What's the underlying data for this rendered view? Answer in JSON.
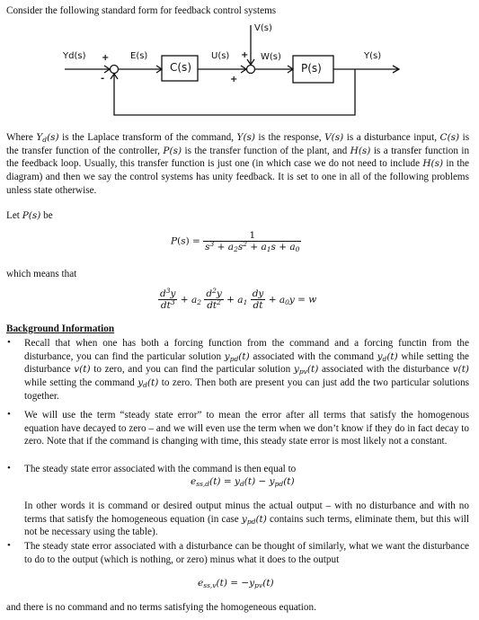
{
  "intro": "Consider the following standard form for feedback control systems",
  "diagram": {
    "labels": {
      "command": "Yd(s)",
      "error": "E(s)",
      "controller": "C(s)",
      "control": "U(s)",
      "disturbance": "V(s)",
      "plant_input": "W(s)",
      "plant": "P(s)",
      "output": "Y(s)"
    },
    "signs": {
      "sum1_top": "+",
      "sum1_bottom": "-",
      "sum2_top": "+",
      "sum2_left": "+"
    }
  },
  "definitions": {
    "p1": "is the Laplace transform of the command,",
    "p2": "is the response,",
    "p3": "is a disturbance input,",
    "p4": "is the transfer function of the controller,",
    "p5": "is the transfer function of the plant, and",
    "p6": "is a transfer function in the feedback loop. Usually, this transfer function is just one (in which case we do not need to include",
    "p7": "in the diagram) and then we say the control systems has unity feedback. It is set to one in all of the following problems unless state otherwise.",
    "where": "Where"
  },
  "let": {
    "prefix": "Let",
    "suffix": "be"
  },
  "equations": {
    "plant_tf_lhs": "P(s) =",
    "plant_tf_num": "1",
    "ode_rhs": "= w",
    "which_means": "which means that"
  },
  "background": {
    "heading": "Background Information",
    "b1": {
      "t1": "Recall that when one has both a forcing function from the command and a forcing functin from the disturbance, you can find the particular solution",
      "t2": "associated with the command",
      "t3": "while setting the disturbance",
      "t4": "to zero, and you can find the particular solution",
      "t5": "associated with the disturbance",
      "t6": "while setting the command",
      "t7": "to zero. Then both are present you can just add the two particular solutions together."
    },
    "b2": "We will use the term “steady state error” to mean the error after all terms that satisfy the homogenous equation have decayed to zero – and we will even use the term when we don’t know if they do in fact decay to zero. Note that if the command is changing with time, this steady state error is most likely not a constant.",
    "b3": {
      "t1": "The steady state error associated with the command is then equal to",
      "t2": "In other words it is command or desired output minus the actual output – with no disturbance and with no terms that satisfy the homogeneous equation (in case",
      "t3": "contains such terms, eliminate them, but this will not be necessary using the table)."
    },
    "b4": "The steady state error associated with a disturbance can be thought of similarly, what we want the disturbance to do to the output (which is nothing, or zero) minus what it does to the output",
    "closing": "and there is no command and no terms satisfying the homogeneous equation."
  }
}
